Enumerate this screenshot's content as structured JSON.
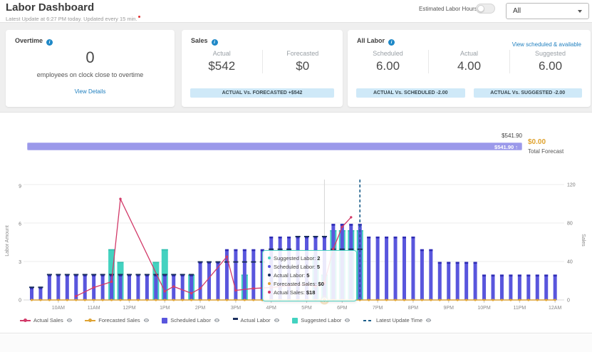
{
  "header": {
    "title": "Labor Dashboard",
    "subtitle": "Latest Update at 6:27 PM today. Updated every 15 min.",
    "estimated_labor_hours_label": "Estimated Labor Hours",
    "filter_value": "All"
  },
  "cards": {
    "overtime": {
      "title": "Overtime",
      "value": "0",
      "description": "employees on clock close to overtime",
      "link": "View Details"
    },
    "sales": {
      "title": "Sales",
      "columns": [
        {
          "label": "Actual",
          "value": "$542"
        },
        {
          "label": "Forecasted",
          "value": "$0"
        }
      ],
      "badge": "ACTUAL Vs. FORECASTED +$542"
    },
    "all_labor": {
      "title": "All Labor",
      "link": "View scheduled & available",
      "columns": [
        {
          "label": "Scheduled",
          "value": "6.00"
        },
        {
          "label": "Actual",
          "value": "4.00"
        },
        {
          "label": "Suggested",
          "value": "6.00"
        }
      ],
      "badges": [
        "ACTUAL Vs. SCHEDULED -2.00",
        "ACTUAL Vs. SUGGESTED -2.00"
      ]
    }
  },
  "forecast_bar": {
    "bar_label": "$541.90",
    "bar_inner_label": "$541.90 ↑",
    "total_value": "$0.00",
    "total_label": "Total Forecast",
    "bar_color": "#9b99ea",
    "total_value_color": "#dfa22e"
  },
  "tooltip": {
    "rows": [
      {
        "label": "Suggested Labor",
        "value": "2",
        "color": "#43d2c0"
      },
      {
        "label": "Scheduled Labor",
        "value": "5",
        "color": "#5956dd"
      },
      {
        "label": "Actual Labor",
        "value": "5",
        "color": "#1b2f5e"
      },
      {
        "label": "Forecasted Sales",
        "value": "$0",
        "color": "#dfa435"
      },
      {
        "label": "Actual Sales",
        "value": "$18",
        "color": "#d23a69"
      }
    ]
  },
  "legend": [
    {
      "label": "Actual Sales",
      "marker": "line-dot",
      "color": "#d23a69"
    },
    {
      "label": "Forecasted Sales",
      "marker": "line-dot",
      "color": "#dfa435"
    },
    {
      "label": "Scheduled Labor",
      "marker": "square",
      "color": "#5956dd"
    },
    {
      "label": "Actual Labor",
      "marker": "dash",
      "color": "#1b2f5e"
    },
    {
      "label": "Suggested Labor",
      "marker": "square",
      "color": "#43d2c0"
    },
    {
      "label": "Latest Update Time",
      "marker": "dashes",
      "color": "#1b5e8a"
    }
  ],
  "chart_data": {
    "type": "combo-bar-line",
    "x_unit_minutes": 15,
    "x_start_time": "9:15AM",
    "hour_labels": [
      "10AM",
      "11AM",
      "12PM",
      "1PM",
      "2PM",
      "3PM",
      "4PM",
      "5PM",
      "6PM",
      "7PM",
      "8PM",
      "9PM",
      "10PM",
      "11PM",
      "12AM"
    ],
    "hour_label_start_index": 3,
    "hour_label_step": 4,
    "left_axis": {
      "title": "Labor Amount",
      "ticks": [
        0,
        3,
        6,
        9
      ]
    },
    "right_axis": {
      "title": "Sales",
      "ticks": [
        0,
        40,
        80,
        120
      ]
    },
    "series": {
      "scheduled_labor": {
        "type": "bar",
        "axis": "left",
        "color": "#5956dd",
        "cap_color": "#2e2cb4",
        "values": [
          1,
          1,
          2,
          2,
          2,
          2,
          2,
          2,
          2,
          2,
          2,
          2,
          2,
          2,
          2,
          2,
          2,
          2,
          2,
          3,
          3,
          3,
          4,
          4,
          4,
          4,
          4,
          5,
          5,
          5,
          5,
          5,
          5,
          5,
          6,
          6,
          6,
          6,
          5,
          5,
          5,
          5,
          5,
          5,
          4,
          4,
          3,
          3,
          3,
          3,
          3,
          2,
          2,
          2,
          2,
          2,
          2,
          2,
          2,
          2
        ]
      },
      "suggested_labor": {
        "type": "bar",
        "axis": "left",
        "color": "#43d2c0",
        "cap_color": "#2fbfae",
        "values": [
          0,
          0,
          0,
          0,
          0,
          0,
          0,
          0,
          0,
          4,
          3,
          0,
          0,
          0,
          3,
          4,
          0,
          0,
          2,
          0,
          0,
          0,
          0,
          0,
          2,
          0,
          0,
          0,
          0,
          0,
          0,
          0,
          3.5,
          2,
          5.5,
          5.5,
          5.5,
          5.5,
          0,
          0,
          0,
          0,
          0,
          0,
          0,
          0,
          0,
          0,
          0,
          0,
          0,
          0,
          0,
          0,
          0,
          0,
          0,
          0,
          0,
          0
        ]
      },
      "actual_labor": {
        "type": "dash",
        "axis": "left",
        "color": "#1b2f5e",
        "values": [
          1,
          1,
          2,
          2,
          2,
          2,
          2,
          2,
          2,
          2,
          2,
          2,
          2,
          2,
          2,
          2,
          2,
          2,
          2,
          3,
          3,
          3,
          3,
          3,
          3,
          3,
          3,
          4,
          4,
          4,
          5,
          5,
          5,
          5,
          4,
          4,
          4,
          4,
          null,
          null,
          null,
          null,
          null,
          null,
          null,
          null,
          null,
          null,
          null,
          null,
          null,
          null,
          null,
          null,
          null,
          null,
          null,
          null,
          null,
          null
        ]
      },
      "forecasted_sales": {
        "type": "line",
        "axis": "right",
        "color": "#dfa435",
        "constant_value": 0
      },
      "actual_sales": {
        "type": "line",
        "axis": "right",
        "color": "#d23a69",
        "points": [
          [
            5,
            4
          ],
          [
            7,
            13
          ],
          [
            9,
            19
          ],
          [
            10,
            105
          ],
          [
            15,
            9
          ],
          [
            16,
            14
          ],
          [
            18,
            7
          ],
          [
            19,
            12
          ],
          [
            22,
            45
          ],
          [
            23,
            10
          ],
          [
            25,
            12
          ],
          [
            27,
            13
          ],
          [
            29,
            15
          ],
          [
            31,
            16
          ],
          [
            32,
            14
          ],
          [
            33,
            18
          ],
          [
            34,
            53
          ],
          [
            35,
            76
          ],
          [
            36,
            86
          ]
        ]
      }
    },
    "latest_update_line": {
      "index": 37,
      "color": "#1b5e8a"
    },
    "hover": {
      "index": 33
    }
  }
}
